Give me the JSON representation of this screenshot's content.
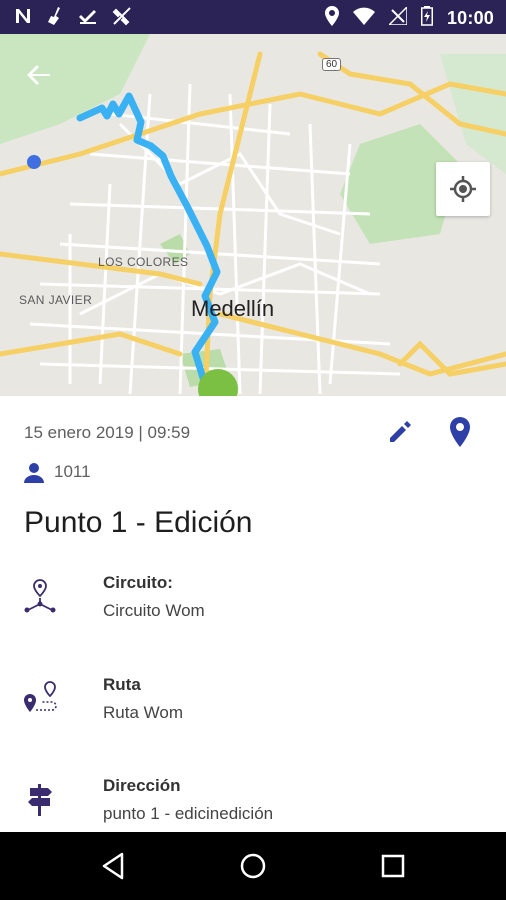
{
  "status_bar": {
    "time": "10:00",
    "left_icons": [
      "n-logo-icon",
      "broom-icon",
      "download-done-icon",
      "satellite-off-icon"
    ],
    "right_icons": [
      "location-icon",
      "wifi-icon",
      "no-signal-icon",
      "battery-charging-icon"
    ]
  },
  "map": {
    "labels": {
      "city": "Medellín",
      "neighborhood_1": "LOS COLORES",
      "neighborhood_2": "SAN JAVIER",
      "road_marker": "60"
    },
    "route_color": "#3ab1f3",
    "end_marker_color": "#7bc043",
    "start_marker_color": "#3f6fe0"
  },
  "detail": {
    "datetime": "15 enero 2019 | 09:59",
    "user_id": "1011",
    "title": "Punto 1 - Edición",
    "fields": [
      {
        "icon": "circuit-icon",
        "label": "Circuito:",
        "value": "Circuito Wom"
      },
      {
        "icon": "route-icon",
        "label": "Ruta",
        "value": "Ruta Wom"
      },
      {
        "icon": "signpost-icon",
        "label": "Dirección",
        "value": "punto 1 - edicinedición"
      }
    ],
    "accent_color": "#2e3fa8",
    "icon_color": "#3a2c6e"
  },
  "nav_bar": {
    "buttons": [
      "back-icon",
      "home-icon",
      "recents-icon"
    ]
  }
}
